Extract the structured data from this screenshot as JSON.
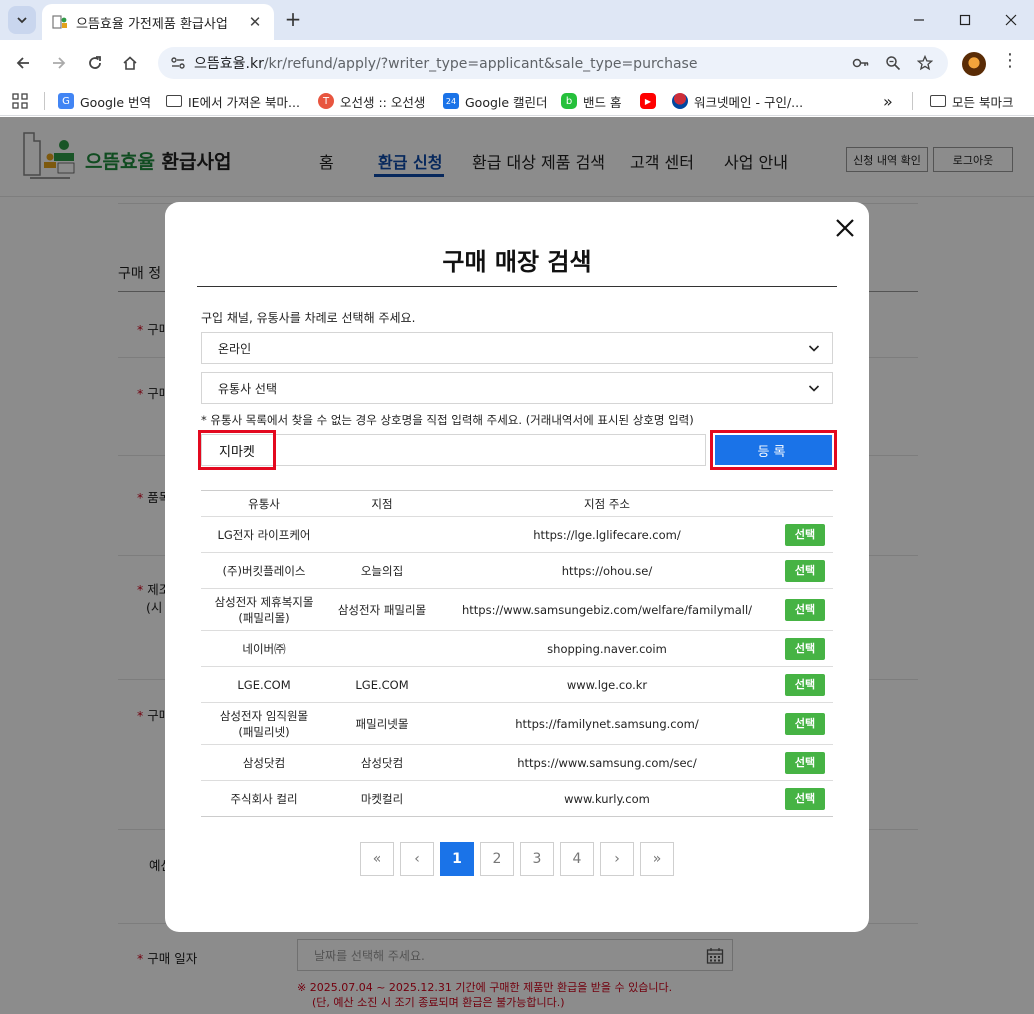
{
  "browser": {
    "tab_title": "으뜸효율 가전제품 환급사업",
    "url_host": "으뜸효율.kr",
    "url_path": "/kr/refund/apply/?writer_type=applicant&sale_type=purchase",
    "bookmarks": [
      {
        "label": "Google 번역"
      },
      {
        "label": "IE에서 가져온 북마..."
      },
      {
        "label": "오선생 :: 오선생"
      },
      {
        "label": "Google 캘린더"
      },
      {
        "label": "밴드 홈"
      },
      {
        "label": "워크넷메인 - 구인/..."
      }
    ],
    "all_bookmarks": "모든 북마크",
    "more": "»"
  },
  "site": {
    "logo_brand": "으뜸효율",
    "logo_suffix": " 환급사업",
    "nav": [
      "홈",
      "환급 신청",
      "환급 대상 제품 검색",
      "고객 센터",
      "사업 안내"
    ],
    "btn_history": "신청 내역 확인",
    "btn_logout": "로그아웃"
  },
  "form": {
    "section_title": "구매 정",
    "labels": [
      "구매",
      "구매",
      "품목",
      "제조",
      "(시",
      "구매",
      "예산",
      "구매 일자"
    ],
    "date_placeholder": "날짜를 선택해 주세요.",
    "notice1": "※ 2025.07.04 ~ 2025.12.31 기간에 구매한 제품만 환급을 받을 수 있습니다.",
    "notice2": "(단, 예산 소진 시 조기 종료되며 환급은 불가능합니다.)"
  },
  "modal": {
    "title": "구매 매장 검색",
    "instruction": "구입 채널, 유통사를 차례로 선택해 주세요.",
    "channel_select": "온라인",
    "distributor_select": "유통사 선택",
    "hint": "* 유통사 목록에서 찾을 수 없는 경우 상호명을 직접 입력해 주세요. (거래내역서에 표시된 상호명 입력)",
    "store_input_value": "지마켓",
    "register_label": "등록",
    "table": {
      "headers": [
        "유통사",
        "지점",
        "지점 주소",
        ""
      ],
      "rows": [
        {
          "distributor": "LG전자 라이프케어",
          "branch": "",
          "address": "https://lge.lglifecare.com/",
          "action": "선택"
        },
        {
          "distributor": "(주)버킷플레이스",
          "branch": "오늘의집",
          "address": "https://ohou.se/",
          "action": "선택"
        },
        {
          "distributor": "삼성전자 제휴복지몰\n(패밀리몰)",
          "branch": "삼성전자 패밀리몰",
          "address": "https://www.samsungebiz.com/welfare/familymall/",
          "action": "선택"
        },
        {
          "distributor": "네이버㈜",
          "branch": "",
          "address": "shopping.naver.coim",
          "action": "선택"
        },
        {
          "distributor": "LGE.COM",
          "branch": "LGE.COM",
          "address": "www.lge.co.kr",
          "action": "선택"
        },
        {
          "distributor": "삼성전자 임직원몰\n(패밀리넷)",
          "branch": "패밀리넷몰",
          "address": "https://familynet.samsung.com/",
          "action": "선택"
        },
        {
          "distributor": "삼성닷컴",
          "branch": "삼성닷컴",
          "address": "https://www.samsung.com/sec/",
          "action": "선택"
        },
        {
          "distributor": "주식회사 컬리",
          "branch": "마켓컬리",
          "address": "www.kurly.com",
          "action": "선택"
        }
      ]
    },
    "pagination": {
      "first": "«",
      "prev": "‹",
      "pages": [
        "1",
        "2",
        "3",
        "4"
      ],
      "next": "›",
      "last": "»",
      "current": "1"
    }
  },
  "colors": {
    "accent_blue": "#1a73e8",
    "select_green": "#46b344",
    "highlight_red": "#e3091f",
    "brand_green": "#1e8a3c",
    "nav_blue": "#0d4aa8"
  }
}
